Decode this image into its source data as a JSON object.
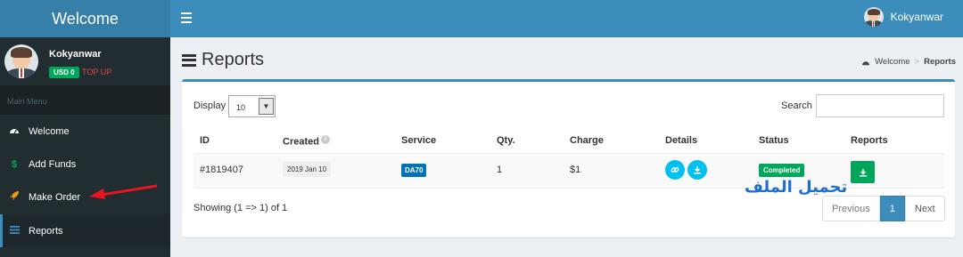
{
  "app": {
    "logo": "Welcome"
  },
  "navbar": {
    "user_name": "Kokyanwar"
  },
  "sidebar": {
    "user_name": "Kokyanwar",
    "balance": "USD 0",
    "topup": "TOP UP",
    "menu_header": "Main Menu",
    "items": [
      {
        "label": "Welcome",
        "icon": "dashboard-icon"
      },
      {
        "label": "Add Funds",
        "icon": "dollar-icon"
      },
      {
        "label": "Make Order",
        "icon": "rocket-icon"
      },
      {
        "label": "Reports",
        "icon": "bars-icon"
      }
    ]
  },
  "page": {
    "title": "Reports",
    "breadcrumb": [
      "Welcome",
      "Reports"
    ]
  },
  "table": {
    "display_label": "Display",
    "display_value": "10",
    "search_label": "Search",
    "headers": [
      "ID",
      "Created",
      "Service",
      "Qty.",
      "Charge",
      "Details",
      "Status",
      "Reports"
    ],
    "rows": [
      {
        "id": "#1819407",
        "created": "2019 Jan 10",
        "service": "DA70",
        "qty": "1",
        "charge": "$1",
        "status": "Completed"
      }
    ],
    "showing": "Showing (1 => 1) of 1"
  },
  "annotation": {
    "arabic_text": "تحميل الملف"
  },
  "pagination": {
    "previous": "Previous",
    "current": "1",
    "next": "Next"
  },
  "colors": {
    "primary": "#3c8dbc",
    "sidebar": "#222d32",
    "success": "#00a65a",
    "info": "#00c0ef",
    "danger": "#dd4b39",
    "annotation_red": "#e8141e"
  }
}
